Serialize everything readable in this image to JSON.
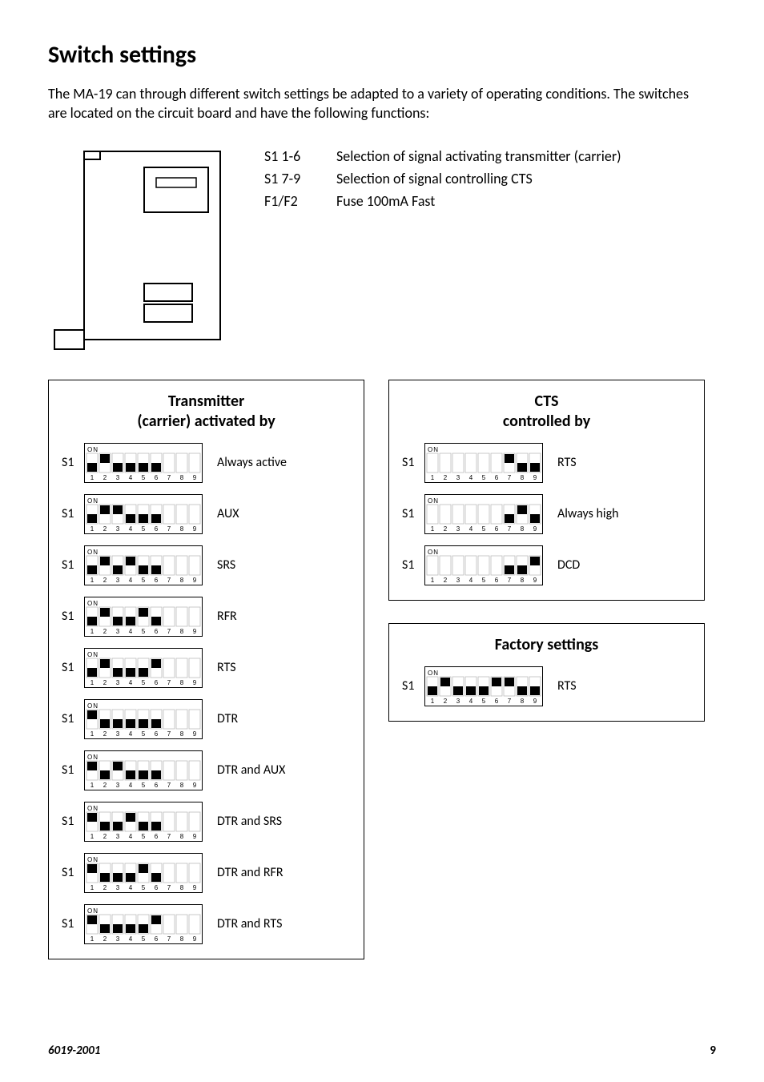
{
  "title": "Switch settings",
  "intro": "The MA-19 can through different switch settings be adapted to a variety of operating conditions. The switches are located on the circuit board and have the following functions:",
  "signals": [
    {
      "label": "S1 1-6",
      "desc": "Selection of signal activating transmitter (carrier)"
    },
    {
      "label": "S1 7-9",
      "desc": "Selection of signal controlling CTS"
    },
    {
      "label": "F1/F2",
      "desc": "Fuse 100mA Fast"
    }
  ],
  "transmitter": {
    "title_line1": "Transmitter",
    "title_line2": "(carrier) activated by",
    "switch_label": "S1",
    "rows": [
      {
        "label": "Always active",
        "pattern": [
          "d",
          "u",
          "d",
          "d",
          "d",
          "d",
          "x",
          "x",
          "x"
        ]
      },
      {
        "label": "AUX",
        "pattern": [
          "d",
          "u",
          "u",
          "d",
          "d",
          "d",
          "x",
          "x",
          "x"
        ]
      },
      {
        "label": "SRS",
        "pattern": [
          "d",
          "u",
          "d",
          "u",
          "d",
          "d",
          "x",
          "x",
          "x"
        ]
      },
      {
        "label": "RFR",
        "pattern": [
          "d",
          "u",
          "d",
          "d",
          "u",
          "d",
          "x",
          "x",
          "x"
        ]
      },
      {
        "label": "RTS",
        "pattern": [
          "d",
          "u",
          "d",
          "d",
          "d",
          "u",
          "x",
          "x",
          "x"
        ]
      },
      {
        "label": "DTR",
        "pattern": [
          "u",
          "d",
          "d",
          "d",
          "d",
          "d",
          "x",
          "x",
          "x"
        ]
      },
      {
        "label": "DTR and AUX",
        "pattern": [
          "u",
          "d",
          "u",
          "d",
          "d",
          "d",
          "x",
          "x",
          "x"
        ]
      },
      {
        "label": "DTR and SRS",
        "pattern": [
          "u",
          "d",
          "d",
          "u",
          "d",
          "d",
          "x",
          "x",
          "x"
        ]
      },
      {
        "label": "DTR and RFR",
        "pattern": [
          "u",
          "d",
          "d",
          "d",
          "u",
          "d",
          "x",
          "x",
          "x"
        ]
      },
      {
        "label": "DTR and RTS",
        "pattern": [
          "u",
          "d",
          "d",
          "d",
          "d",
          "u",
          "x",
          "x",
          "x"
        ]
      }
    ]
  },
  "cts": {
    "title_line1": "CTS",
    "title_line2": "controlled by",
    "switch_label": "S1",
    "rows": [
      {
        "label": "RTS",
        "pattern": [
          "x",
          "x",
          "x",
          "x",
          "x",
          "x",
          "u",
          "d",
          "d"
        ]
      },
      {
        "label": "Always high",
        "pattern": [
          "x",
          "x",
          "x",
          "x",
          "x",
          "x",
          "d",
          "u",
          "d"
        ]
      },
      {
        "label": "DCD",
        "pattern": [
          "x",
          "x",
          "x",
          "x",
          "x",
          "x",
          "d",
          "d",
          "u"
        ]
      }
    ]
  },
  "factory": {
    "title": "Factory settings",
    "switch_label": "S1",
    "rows": [
      {
        "label": "RTS",
        "pattern": [
          "d",
          "u",
          "d",
          "d",
          "d",
          "u",
          "u",
          "d",
          "d"
        ]
      }
    ]
  },
  "footer": {
    "doc_id": "6019-2001",
    "page": "9"
  }
}
